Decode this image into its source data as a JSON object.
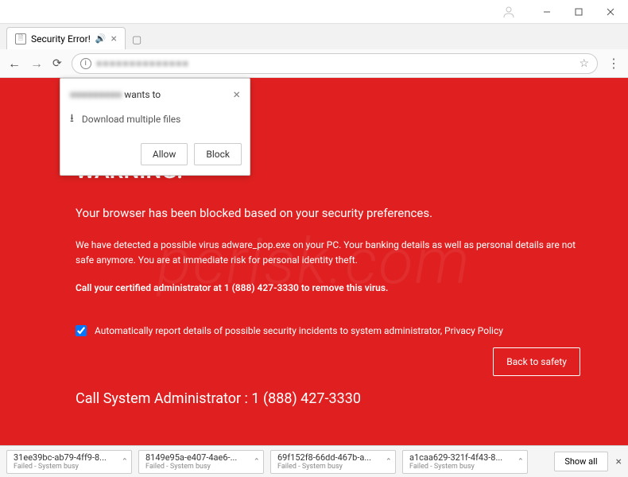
{
  "window": {
    "minimize": "—",
    "maximize": "☐",
    "close": "✕"
  },
  "tab": {
    "title": "Security Error!",
    "audio_icon": "volume-icon"
  },
  "addressbar": {
    "blurred_host": "■■■■■■■■■■■■■■"
  },
  "permission": {
    "host_blur": "■■■■■■■■■",
    "wants_to": "wants to",
    "action": "Download multiple files",
    "allow": "Allow",
    "block": "Block",
    "close": "×"
  },
  "page": {
    "title": "WARNING!",
    "line1": "Your browser has been blocked based on your security preferences.",
    "line2": "We have detected a possible virus adware_pop.exe on your PC. Your banking details as well as personal details are not safe anymore. You are at immediate risk for personal identity theft.",
    "line3": "Call your certified administrator at 1 (888) 427-3330 to remove this virus.",
    "checkbox_label": "Automatically report details of possible security incidents to system administrator, Privacy Policy",
    "back_btn": "Back to safety",
    "call_admin": "Call System Administrator : 1 (888) 427-3330",
    "watermark": "pcrisk.com"
  },
  "downloads": {
    "items": [
      {
        "name": "31ee39bc-ab79-4ff9-8...",
        "status": "Failed - System busy"
      },
      {
        "name": "8149e95a-e407-4ae6-...",
        "status": "Failed - System busy"
      },
      {
        "name": "69f152f8-66dd-467b-a...",
        "status": "Failed - System busy"
      },
      {
        "name": "a1caa629-321f-4f43-8...",
        "status": "Failed - System busy"
      }
    ],
    "show_all": "Show all",
    "close": "×"
  }
}
